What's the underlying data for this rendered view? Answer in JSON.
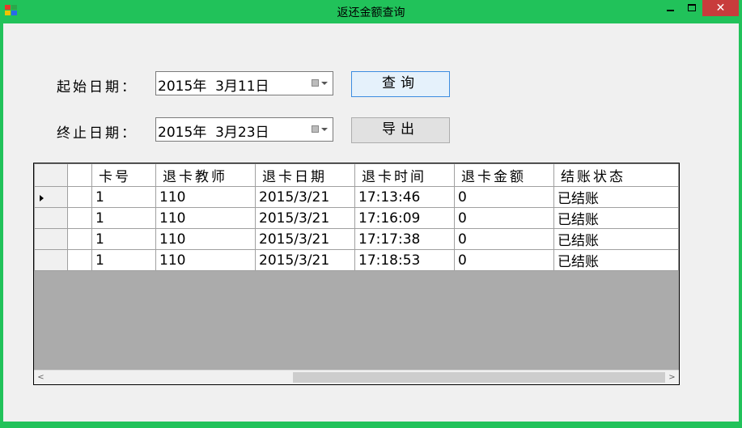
{
  "window": {
    "title": "返还金额查询",
    "close_glyph": "✕",
    "icon_colors": [
      "#e83a2a",
      "#2aa84a",
      "#f2c200",
      "#2a6ae8"
    ]
  },
  "form": {
    "start_label": "起始日期：",
    "start_value": "2015年  3月11日",
    "end_label": "终止日期：",
    "end_value": "2015年  3月23日",
    "query_button": "查询",
    "export_button": "导出"
  },
  "grid": {
    "columns": [
      "",
      "卡号",
      "退卡教师",
      "退卡日期",
      "退卡时间",
      "退卡金额",
      "结账状态"
    ],
    "rows": [
      [
        "",
        "1",
        "110",
        "2015/3/21",
        "17:13:46",
        "0",
        "已结账"
      ],
      [
        "",
        "1",
        "110",
        "2015/3/21",
        "17:16:09",
        "0",
        "已结账"
      ],
      [
        "",
        "1",
        "110",
        "2015/3/21",
        "17:17:38",
        "0",
        "已结账"
      ],
      [
        "",
        "1",
        "110",
        "2015/3/21",
        "17:18:53",
        "0",
        "已结账"
      ]
    ],
    "scroll_left": "<",
    "scroll_right": ">"
  }
}
